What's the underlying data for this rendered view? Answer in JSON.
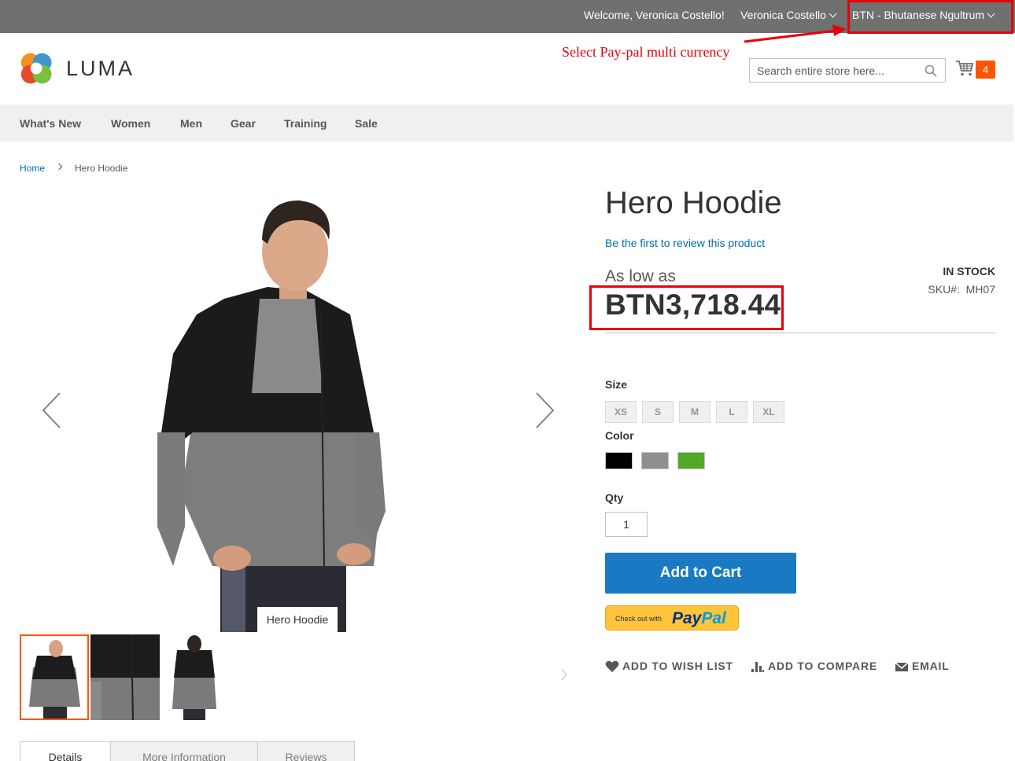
{
  "topbar": {
    "welcome": "Welcome, Veronica Costello!",
    "account": "Veronica Costello",
    "currency": "BTN - Bhutanese Ngultrum"
  },
  "annotation": {
    "text": "Select Pay-pal multi currency",
    "color": "#e8000b"
  },
  "header": {
    "logo_text": "LUMA",
    "search_placeholder": "Search entire store here...",
    "cart_count": "4"
  },
  "nav": {
    "items": [
      "What's New",
      "Women",
      "Men",
      "Gear",
      "Training",
      "Sale"
    ]
  },
  "breadcrumb": {
    "home": "Home",
    "current": "Hero Hoodie"
  },
  "gallery": {
    "caption": "Hero Hoodie",
    "thumb_count": 3,
    "active_thumb": 1
  },
  "tabs": [
    "Details",
    "More Information",
    "Reviews"
  ],
  "product": {
    "name": "Hero Hoodie",
    "review_link": "Be the first to review this product",
    "price_label": "As low as",
    "price": "BTN3,718.44",
    "stock": "IN STOCK",
    "sku_label": "SKU#:",
    "sku": "MH07",
    "size_label": "Size",
    "sizes": [
      "XS",
      "S",
      "M",
      "L",
      "XL"
    ],
    "color_label": "Color",
    "colors": [
      "#000000",
      "#8f8f8f",
      "#53a828"
    ],
    "qty_label": "Qty",
    "qty": "1",
    "add_to_cart": "Add to Cart",
    "paypal_prefix": "Check out with",
    "paypal_word1": "Pay",
    "paypal_word2": "Pal"
  },
  "actions": {
    "wishlist": "ADD TO WISH LIST",
    "compare": "ADD TO COMPARE",
    "email": "EMAIL"
  },
  "colors": {
    "topbar": "#6e716e",
    "link": "#006bb4",
    "primary_button": "#1979c3",
    "cart_badge": "#ff5501"
  }
}
